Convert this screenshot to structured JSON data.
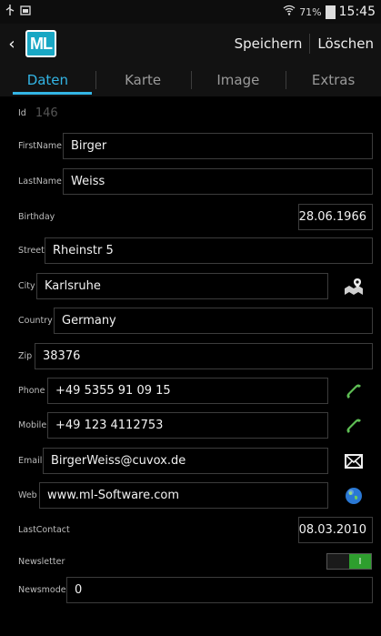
{
  "status": {
    "battery": "71%",
    "time": "15:45"
  },
  "actionbar": {
    "logo": "ML",
    "save": "Speichern",
    "delete": "Löschen"
  },
  "tabs": [
    "Daten",
    "Karte",
    "Image",
    "Extras"
  ],
  "form": {
    "id": {
      "label": "Id",
      "value": "146"
    },
    "firstname": {
      "label": "FirstName",
      "value": "Birger"
    },
    "lastname": {
      "label": "LastName",
      "value": "Weiss"
    },
    "birthday": {
      "label": "Birthday",
      "value": "28.06.1966"
    },
    "street": {
      "label": "Street",
      "value": "Rheinstr 5"
    },
    "city": {
      "label": "City",
      "value": "Karlsruhe"
    },
    "country": {
      "label": "Country",
      "value": "Germany"
    },
    "zip": {
      "label": "Zip",
      "value": "38376"
    },
    "phone": {
      "label": "Phone",
      "value": "+49 5355 91 09 15"
    },
    "mobile": {
      "label": "Mobile",
      "value": "+49 123 4112753"
    },
    "email": {
      "label": "Email",
      "value": "BirgerWeiss@cuvox.de"
    },
    "web": {
      "label": "Web",
      "value": "www.ml-Software.com"
    },
    "lastcontact": {
      "label": "LastContact",
      "value": "08.03.2010"
    },
    "newsletter": {
      "label": "Newsletter",
      "toggle_on_text": "I",
      "checked": true
    },
    "newsmode": {
      "label": "Newsmode",
      "value": "0"
    }
  },
  "colors": {
    "accent": "#33b5e5",
    "toggle_on": "#2e9e2e"
  },
  "icons": {
    "map": "map-icon",
    "phone": "phone-icon",
    "mobile": "phone-icon",
    "email": "envelope-icon",
    "web": "globe-icon"
  }
}
